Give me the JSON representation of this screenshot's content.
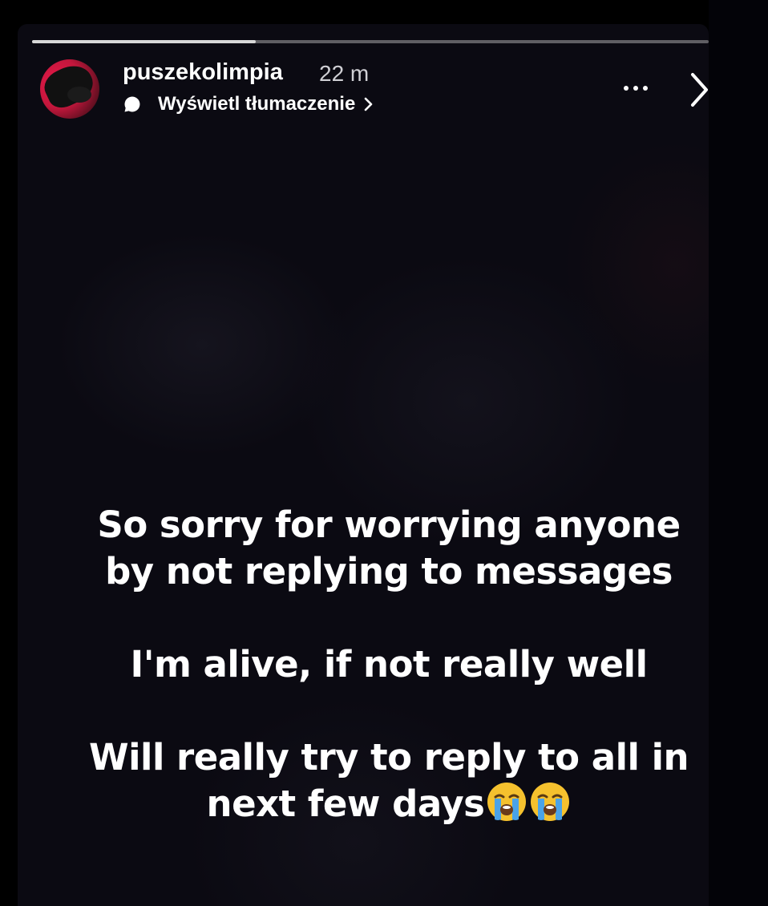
{
  "story": {
    "progress_fraction": 0.33,
    "username": "puszekolimpia",
    "timestamp": "22 m",
    "translate_label": "Wyświetl tłumaczenie",
    "icons": {
      "translate": "speech-bubble-icon",
      "translate_chevron": "chevron-right-icon",
      "more": "more-options-icon",
      "next": "chevron-right-icon",
      "emoji": "loudly-crying-face-emoji"
    }
  },
  "caption": {
    "line1": "So sorry for worrying anyone",
    "line2": "by not replying to messages",
    "line3": "I'm alive, if not really well",
    "line4": "Will really try to reply to all in",
    "line5": "next few days"
  },
  "colors": {
    "background": "#000000",
    "story_background": "#0b0a12",
    "text": "#ffffff",
    "timestamp": "#cfcfd4",
    "avatar_accent": "#e8184a"
  }
}
